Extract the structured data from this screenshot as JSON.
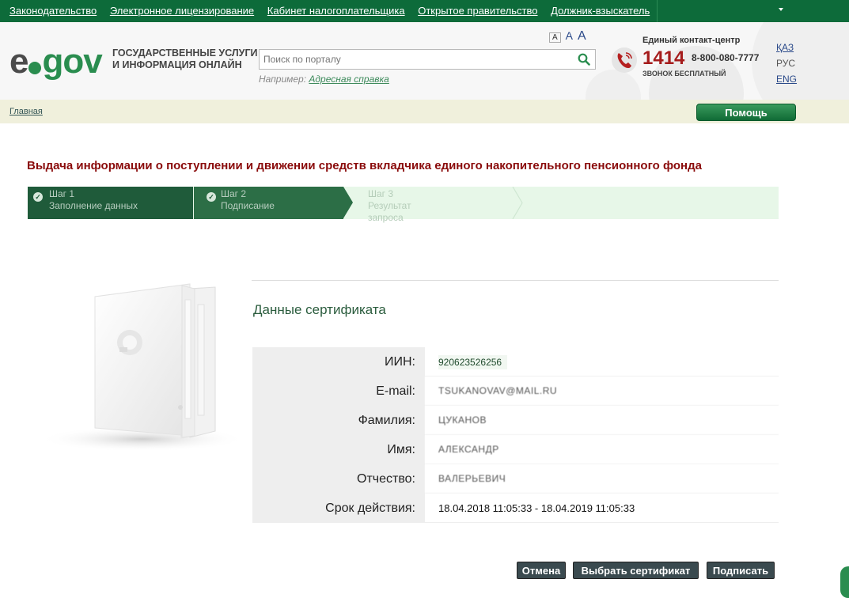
{
  "top_nav": {
    "links": [
      "Законодательство",
      "Электронное лицензирование",
      "Кабинет налогоплательщика",
      "Открытое правительство",
      "Должник-взыскатель"
    ]
  },
  "header": {
    "logo_e": "e",
    "logo_gov": "gov",
    "slogan_line1": "ГОСУДАРСТВЕННЫЕ УСЛУГИ",
    "slogan_line2": "И ИНФОРМАЦИЯ ОНЛАЙН",
    "search_placeholder": "Поиск по порталу",
    "example_label": "Например:",
    "example_link": "Адресная справка",
    "font_sizes": [
      "A",
      "A",
      "A"
    ],
    "contact_title": "Единый контакт-центр",
    "contact_short": "1414",
    "contact_phone": "8-800-080-7777",
    "contact_free": "ЗВОНОК БЕСПЛАТНЫЙ",
    "languages": [
      "ҚАЗ",
      "РУС",
      "ENG"
    ]
  },
  "breadcrumb": {
    "home": "Главная"
  },
  "help_button": "Помощь",
  "page_title": "Выдача информации о поступлении и движении средств вкладчика единого накопительного пенсионного фонда",
  "steps": [
    {
      "num": "Шаг 1",
      "name": "Заполнение данных"
    },
    {
      "num": "Шаг 2",
      "name": "Подписание"
    },
    {
      "num": "Шаг 3",
      "name": "Результат запроса"
    }
  ],
  "certificate": {
    "title": "Данные сертификата",
    "rows": [
      {
        "label": "ИИН:",
        "value": "920623526256"
      },
      {
        "label": "E-mail:",
        "value": "TSUKANOVAV@MAIL.RU"
      },
      {
        "label": "Фамилия:",
        "value": "ЦУКАНОВ"
      },
      {
        "label": "Имя:",
        "value": "АЛЕКСАНДР"
      },
      {
        "label": "Отчество:",
        "value": "ВАЛЕРЬЕВИЧ"
      },
      {
        "label": "Срок действия:",
        "value": "18.04.2018 11:05:33 - 18.04.2019 11:05:33"
      }
    ]
  },
  "buttons": {
    "cancel": "Отмена",
    "choose": "Выбрать сертификат",
    "sign": "Подписать"
  },
  "colors": {
    "brand_green": "#0d6b3a",
    "title_red": "#8a0b0b",
    "step_dark": "#1f5b3a"
  }
}
